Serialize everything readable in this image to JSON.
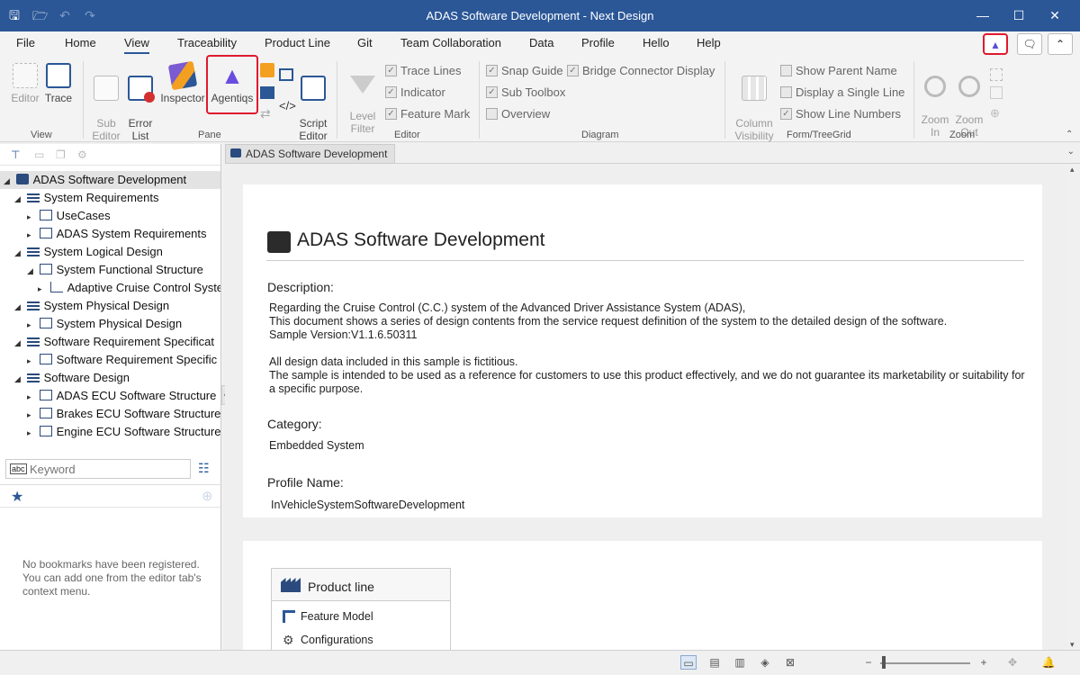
{
  "window": {
    "title": "ADAS Software Development - Next Design",
    "minimize": "—",
    "maximize": "☐",
    "close": "✕"
  },
  "menu": {
    "items": [
      "File",
      "Home",
      "View",
      "Traceability",
      "Product Line",
      "Git",
      "Team Collaboration",
      "Data",
      "Profile",
      "Hello",
      "Help"
    ],
    "active": "View"
  },
  "ribbon": {
    "view_group": {
      "label": "View",
      "editor": "Editor",
      "trace": "Trace"
    },
    "pane_group": {
      "label": "Pane",
      "sub_editor": "Sub\nEditor",
      "error_list": "Error\nList",
      "inspector": "Inspector",
      "agentiqs": "Agentiqs",
      "script_editor": "Script\nEditor"
    },
    "editor_group": {
      "label": "Editor",
      "level_filter": "Level\nFilter",
      "trace_lines": "Trace Lines",
      "indicator": "Indicator",
      "feature_mark": "Feature Mark"
    },
    "diagram_group": {
      "label": "Diagram",
      "snap_guide": "Snap Guide",
      "bridge_connector": "Bridge Connector Display",
      "sub_toolbox": "Sub Toolbox",
      "overview": "Overview"
    },
    "formtree_group": {
      "label": "Form/TreeGrid",
      "column_visibility": "Column\nVisibility",
      "show_parent_name": "Show Parent Name",
      "display_single_line": "Display a Single Line",
      "show_line_numbers": "Show Line Numbers"
    },
    "zoom_group": {
      "label": "Zoom",
      "zoom_in": "Zoom\nIn",
      "zoom_out": "Zoom\nOut"
    }
  },
  "tree": {
    "root": "ADAS Software Development",
    "nodes": [
      "System Requirements",
      "UseCases",
      "ADAS System Requirements",
      "System Logical Design",
      "System Functional Structure",
      "Adaptive Cruise Control Syste",
      "System Physical Design",
      "System Physical Design",
      "Software Requirement Specificat",
      "Software Requirement Specific",
      "Software Design",
      "ADAS ECU Software Structure",
      "Brakes ECU Software Structure",
      "Engine ECU Software Structure"
    ]
  },
  "search": {
    "placeholder": "Keyword"
  },
  "bookmarks": {
    "empty_note": "No bookmarks have been registered. You can add one from the editor tab's context menu."
  },
  "doc_tab": {
    "label": "ADAS Software Development"
  },
  "document": {
    "title": "ADAS Software Development",
    "description_label": "Description:",
    "description_lines": [
      "Regarding the Cruise Control (C.C.) system of the Advanced Driver Assistance System (ADAS),",
      "This document shows a series of design contents from the service request definition of the system to the detailed design of the software.",
      "Sample Version:V1.1.6.50311",
      "",
      "All design data included in this sample is fictitious.",
      "The sample is intended to be used as a reference for customers to use this product effectively, and we do not guarantee its marketability or suitability for a specific purpose."
    ],
    "category_label": "Category:",
    "category_value": "Embedded System",
    "profile_label": "Profile Name:",
    "profile_value": "InVehicleSystemSoftwareDevelopment"
  },
  "product_line": {
    "title": "Product line",
    "items": [
      "Feature Model",
      "Configurations"
    ]
  }
}
